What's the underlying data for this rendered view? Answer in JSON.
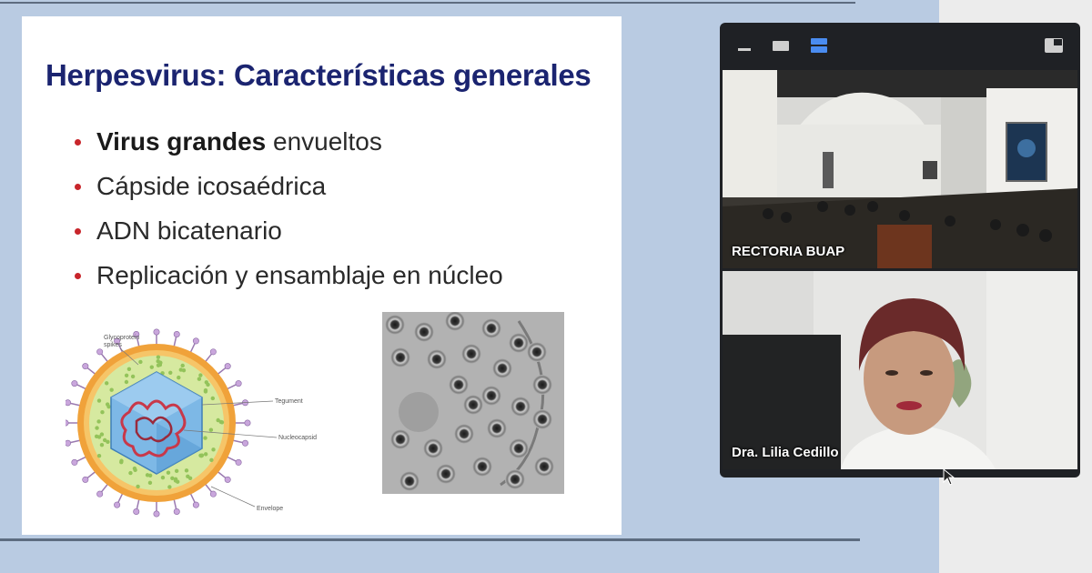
{
  "slide": {
    "title": "Herpesvirus: Características generales",
    "bullets": [
      {
        "bold": "Virus grandes",
        "rest": " envueltos"
      },
      {
        "bold": "",
        "rest": "Cápside icosaédrica"
      },
      {
        "bold": "",
        "rest": "ADN bicatenario"
      },
      {
        "bold": "",
        "rest": "Replicación y ensamblaje en núcleo"
      }
    ],
    "bullet_color": "#c8252b",
    "title_color": "#1b2470",
    "diagram_labels": {
      "glycoprotein": "Glycoprotein",
      "spikes": "spikes",
      "tegument": "Tegument",
      "nucleocapsid": "Nucleocapsid",
      "envelope": "Envelope"
    }
  },
  "video": {
    "toolbar_icons": [
      "minimize-icon",
      "single-view-icon",
      "speaker-view-icon",
      "exit-pip-icon"
    ],
    "active_color": "#4a8cf0",
    "participants": [
      {
        "name": "RECTORIA BUAP"
      },
      {
        "name": "Dra. Lilia Cedillo"
      }
    ]
  }
}
